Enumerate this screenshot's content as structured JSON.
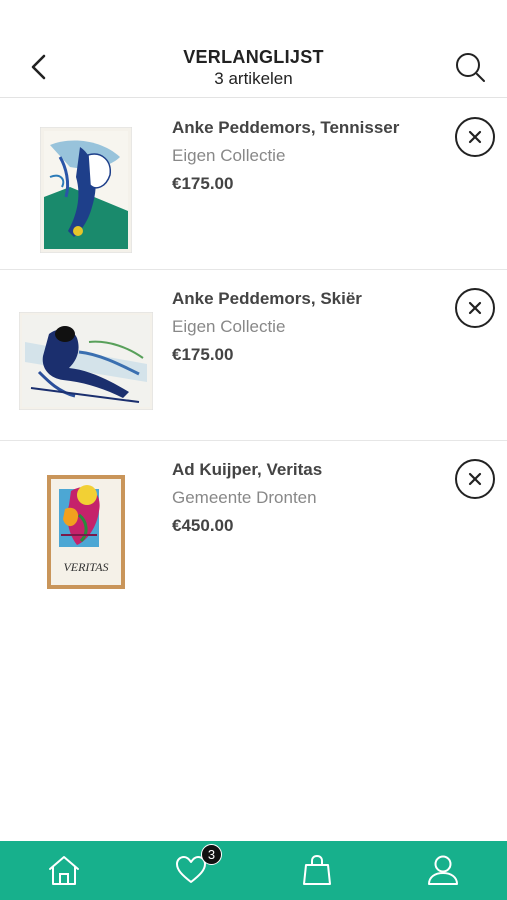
{
  "header": {
    "title": "VERLANGLIJST",
    "subtitle": "3 artikelen"
  },
  "items": [
    {
      "artist_title": "Anke Peddemors, Tennisser",
      "collection": "Eigen Collectie",
      "price": "€175.00"
    },
    {
      "artist_title": "Anke Peddemors, Skiër",
      "collection": "Eigen Collectie",
      "price": "€175.00"
    },
    {
      "artist_title": "Ad Kuijper, Veritas",
      "collection": "Gemeente Dronten",
      "price": "€450.00",
      "artwork_text": "VERITAS"
    }
  ],
  "tabbar": {
    "wishlist_count": "3",
    "accent_color": "#17b08c"
  },
  "icons": [
    "chevron-left-icon",
    "search-icon",
    "close-icon",
    "home-icon",
    "heart-icon",
    "bag-icon",
    "user-icon"
  ]
}
